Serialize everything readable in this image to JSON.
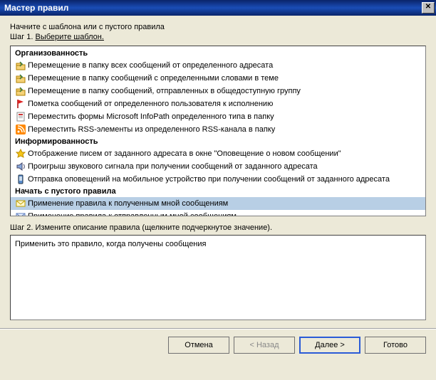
{
  "window": {
    "title": "Мастер правил"
  },
  "intro": "Начните с шаблона или с пустого правила",
  "step1": {
    "prefix": "Шаг 1. ",
    "text": "Выберите шаблон."
  },
  "groups": {
    "org": "Организованность",
    "info": "Информированность",
    "blank": "Начать с пустого правила"
  },
  "items": {
    "org1": "Перемещение в папку всех сообщений от определенного адресата",
    "org2": "Перемещение в папку сообщений с определенными словами в теме",
    "org3": "Перемещение в папку сообщений, отправленных в общедоступную группу",
    "org4": "Пометка сообщений от определенного пользователя к исполнению",
    "org5": "Переместить формы Microsoft InfoPath определенного типа в папку",
    "org6": "Переместить RSS-элементы из определенного RSS-канала в папку",
    "info1": "Отображение писем от заданного адресата в окне \"Оповещение о новом сообщении\"",
    "info2": "Проигрыш звукового сигнала при получении сообщений от заданного адресата",
    "info3": "Отправка оповещений на мобильное устройство при получении сообщений от заданного адресата",
    "blank1": "Применение правила к полученным мной сообщениям",
    "blank2": "Применение правила к отправленным мной сообщениям"
  },
  "step2": "Шаг 2. Измените описание правила (щелкните подчеркнутое значение).",
  "description": "Применить это правило, когда получены сообщения",
  "buttons": {
    "cancel": "Отмена",
    "back": "< Назад",
    "next": "Далее >",
    "finish": "Готово"
  }
}
